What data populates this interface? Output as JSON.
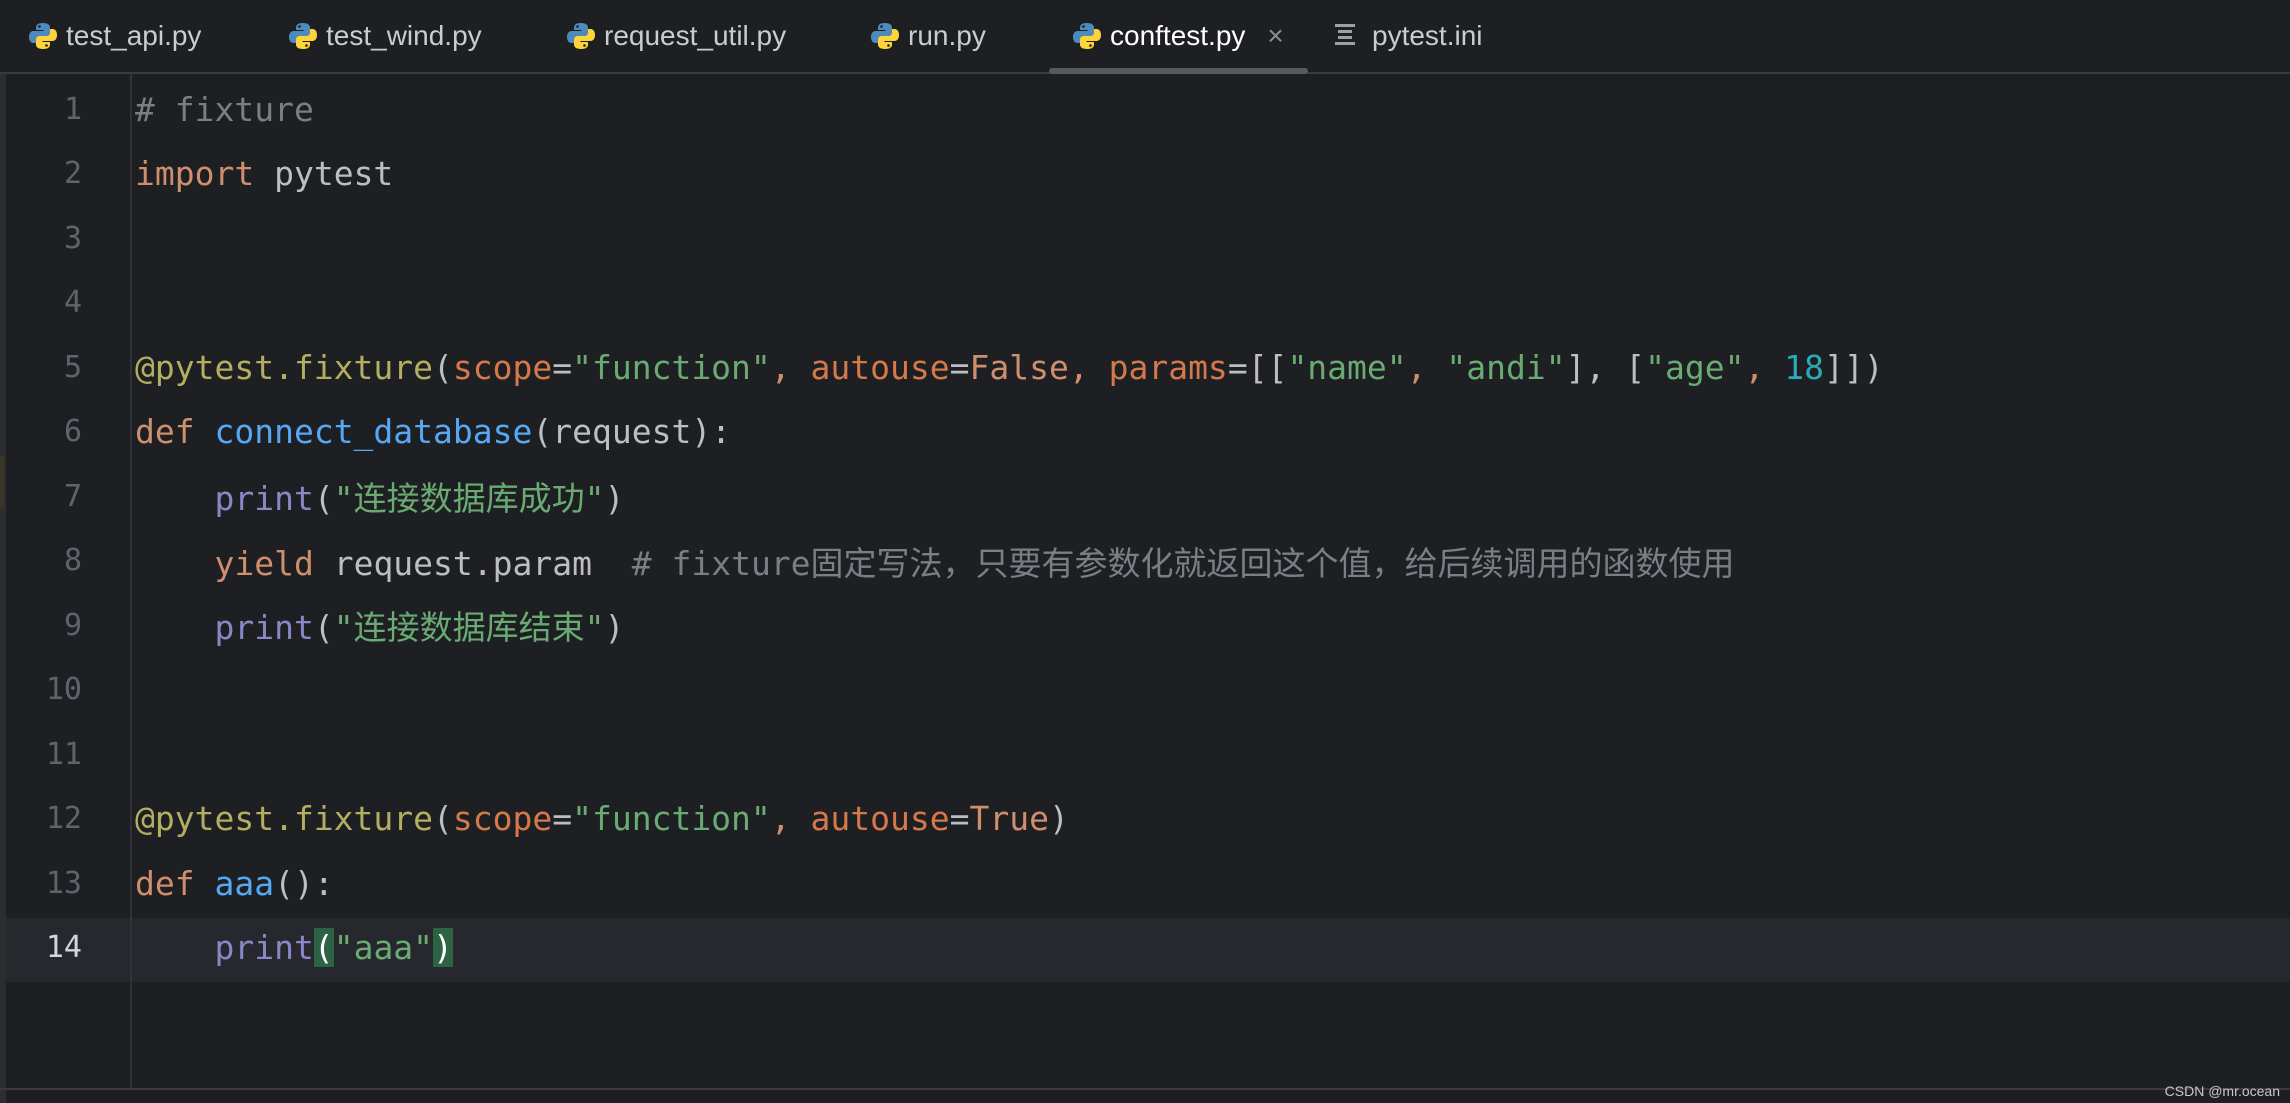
{
  "tabs": [
    {
      "label": "test_api.py",
      "icon": "python-icon",
      "active": false
    },
    {
      "label": "test_wind.py",
      "icon": "python-icon",
      "active": false
    },
    {
      "label": "request_util.py",
      "icon": "python-icon",
      "active": false
    },
    {
      "label": "run.py",
      "icon": "python-icon",
      "active": false
    },
    {
      "label": "conftest.py",
      "icon": "python-icon",
      "active": true,
      "close": "×"
    },
    {
      "label": "pytest.ini",
      "icon": "ini-file-icon",
      "active": false
    }
  ],
  "editor": {
    "current_line": 14,
    "line_numbers": [
      "1",
      "2",
      "3",
      "4",
      "5",
      "6",
      "7",
      "8",
      "9",
      "10",
      "11",
      "12",
      "13",
      "14"
    ],
    "lines": {
      "l1": {
        "comment": "# fixture"
      },
      "l2": {
        "kw": "import",
        "module": "pytest"
      },
      "l5": {
        "decorator": "@pytest.fixture",
        "open": "(",
        "scope_kw": "scope",
        "eq1": "=",
        "scope_val": "\"function\"",
        "comma1": ", ",
        "autouse_kw": "autouse",
        "eq2": "=",
        "autouse_val": "False",
        "comma2": ", ",
        "params_kw": "params",
        "eq3": "=",
        "b1": "[[",
        "s1": "\"name\"",
        "c3": ", ",
        "s2": "\"andi\"",
        "b2": "], [",
        "s3": "\"age\"",
        "c4": ", ",
        "n1": "18",
        "b3": "]])"
      },
      "l6": {
        "kw": "def",
        "name": "connect_database",
        "args": "(request):"
      },
      "l7": {
        "fn": "print",
        "open": "(",
        "str": "\"连接数据库成功\"",
        "close": ")"
      },
      "l8": {
        "kw": "yield",
        "expr": "request.param",
        "comment": "# fixture固定写法，只要有参数化就返回这个值，给后续调用的函数使用"
      },
      "l9": {
        "fn": "print",
        "open": "(",
        "str": "\"连接数据库结束\"",
        "close": ")"
      },
      "l12": {
        "decorator": "@pytest.fixture",
        "open": "(",
        "scope_kw": "scope",
        "eq1": "=",
        "scope_val": "\"function\"",
        "comma1": ", ",
        "autouse_kw": "autouse",
        "eq2": "=",
        "autouse_val": "True",
        "close": ")"
      },
      "l13": {
        "kw": "def",
        "name": "aaa",
        "args": "():"
      },
      "l14": {
        "fn": "print",
        "open": "(",
        "str": "\"aaa\"",
        "close": ")"
      }
    }
  },
  "watermark": "CSDN @mr.ocean",
  "colors": {
    "background": "#1e1f22",
    "keyword": "#cf8e6d",
    "string": "#6aab73",
    "decorator": "#b3ae60",
    "comment": "#7a7e85",
    "number": "#2aacb8",
    "builtin": "#8888c6",
    "param": "#d5794b",
    "bracket_match": "#2e6244"
  }
}
